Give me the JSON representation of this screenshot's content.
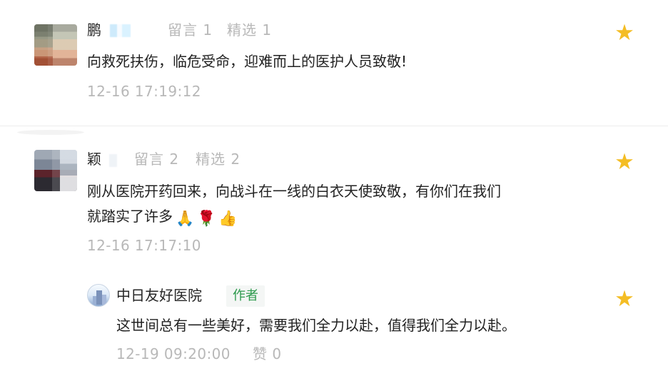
{
  "comments": [
    {
      "name": "鹏",
      "message_count_label": "留言 1",
      "featured_count_label": "精选 1",
      "content": "向救死扶伤，临危受命，迎难而上的医护人员致敬!",
      "time": "12-16 17:19:12",
      "star_icon": "star-icon"
    },
    {
      "name": "颖",
      "message_count_label": "留言 2",
      "featured_count_label": "精选 2",
      "content_line_1": "刚从医院开药回来，向战斗在一线的白衣天使致敬，有你们在我们",
      "content_line_2": "就踏实了许多",
      "emojis": [
        "🙏",
        "🌹",
        "👍"
      ],
      "time": "12-16 17:17:10",
      "star_icon": "star-icon"
    }
  ],
  "reply": {
    "name": "中日友好医院",
    "badge": "作者",
    "content": "这世间总有一些美好，需要我们全力以赴，值得我们全力以赴。",
    "time": "12-19 09:20:00",
    "likes_label": "赞 0",
    "star_icon": "star-icon"
  },
  "colors": {
    "star": "#f4bd24",
    "author_badge_text": "#2d9a4d",
    "meta_text": "#b8b8b8",
    "divider": "#ececec"
  }
}
